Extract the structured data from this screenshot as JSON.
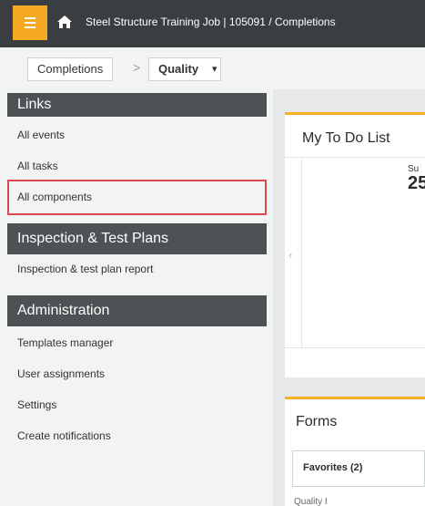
{
  "header": {
    "title": "Steel Structure Training Job | 105091  /  Completions"
  },
  "breadcrumb": {
    "module": "Completions",
    "separator": ">",
    "current": "Quality",
    "dropdown_caret": "▾"
  },
  "sidebar": {
    "sections": [
      {
        "title": "Links",
        "items": [
          "All events",
          "All tasks",
          "All components"
        ]
      },
      {
        "title": "Inspection & Test Plans",
        "items": [
          "Inspection & test plan report"
        ]
      },
      {
        "title": "Administration",
        "items": [
          "Templates manager",
          "User assignments",
          "Settings",
          "Create notifications"
        ]
      }
    ],
    "highlighted_item": "All components"
  },
  "todo_card": {
    "title": "My To Do List",
    "nav_prev": "‹",
    "stat_label": "Su",
    "stat_value": "25"
  },
  "forms_card": {
    "title": "Forms",
    "tab_label": "Favorites (2)",
    "cut_text": "Quality I"
  },
  "colors": {
    "accent": "#f5a923",
    "topbar": "#3b3e40",
    "section_header": "#4d5254",
    "highlight": "#e0474c"
  }
}
